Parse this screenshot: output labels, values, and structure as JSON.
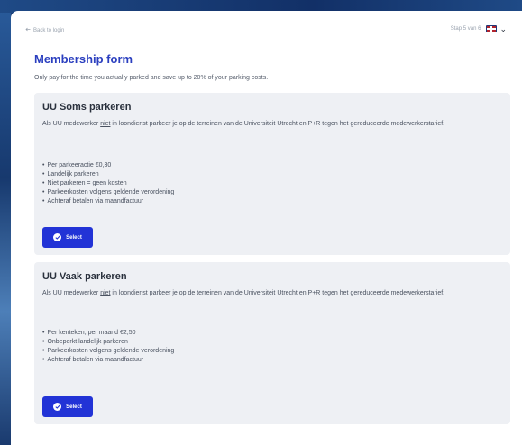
{
  "nav": {
    "back_label": "Back to login",
    "step_label": "Stap 5 van 6"
  },
  "form": {
    "title": "Membership form",
    "subtitle": "Only pay for the time you actually parked and save up to 20% of your parking costs."
  },
  "options": [
    {
      "title": "UU Soms parkeren",
      "desc_before": "Als UU medewerker ",
      "desc_underlined": "niet",
      "desc_after": " in loondienst parkeer je op de terreinen van de Universiteit Utrecht en P+R tegen het gereduceerde medewerkerstarief.",
      "bullets": [
        "Per parkeeractie €0,30",
        "Landelijk parkeren",
        "Niet parkeren = geen kosten",
        "Parkeerkosten volgens geldende verordening",
        "Achteraf betalen via maandfactuur"
      ],
      "button_label": "Select"
    },
    {
      "title": "UU Vaak parkeren",
      "desc_before": "Als UU medewerker ",
      "desc_underlined": "niet",
      "desc_after": " in loondienst parkeer je op de terreinen van de Universiteit Utrecht en P+R tegen het gereduceerde medewerkerstarief.",
      "bullets": [
        "Per kenteken, per maand €2,50",
        "Onbeperkt landelijk parkeren",
        "Parkeerkosten volgens geldende verordening",
        "Achteraf betalen via maandfactuur"
      ],
      "button_label": "Select"
    }
  ],
  "colors": {
    "accent": "#2233d6",
    "title": "#2b3fbf",
    "card_bg": "#eef0f4"
  },
  "icons": {
    "back": "arrow-left-icon",
    "flag": "uk-flag-icon",
    "dropdown": "chevron-down-icon",
    "button": "check-circle-icon"
  }
}
